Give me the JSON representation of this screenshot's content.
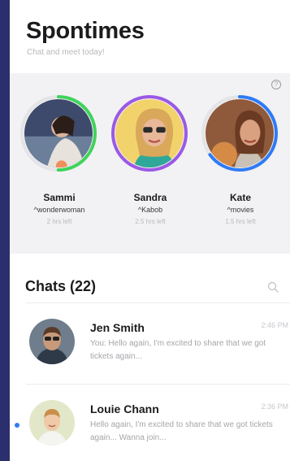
{
  "app": {
    "title": "Spontimes",
    "subtitle": "Chat and meet today!"
  },
  "stories": {
    "help_icon": "?",
    "items": [
      {
        "name": "Sammi",
        "tag": "^wonderwoman",
        "time_left": "2 hrs left",
        "ring_color": "#3fd35b",
        "ring_progress": 0.5
      },
      {
        "name": "Sandra",
        "tag": "^Kabob",
        "time_left": "2.5 hrs left",
        "ring_color": "#9b59e6",
        "ring_progress": 1.0
      },
      {
        "name": "Kate",
        "tag": "^movies",
        "time_left": "1.5 hrs left",
        "ring_color": "#2f7bf6",
        "ring_progress": 0.65
      }
    ]
  },
  "chats": {
    "title": "Chats (22)",
    "items": [
      {
        "name": "Jen Smith",
        "time": "2:46 PM",
        "message": "You: Hello again, I'm excited to share that we got tickets again...",
        "unread": false
      },
      {
        "name": "Louie Chann",
        "time": "2:36 PM",
        "message": "Hello again, I'm excited to share that we got tickets again... Wanna join...",
        "unread": true
      }
    ]
  },
  "colors": {
    "background": "#2b2f6e",
    "accent": "#2f7bf6"
  }
}
